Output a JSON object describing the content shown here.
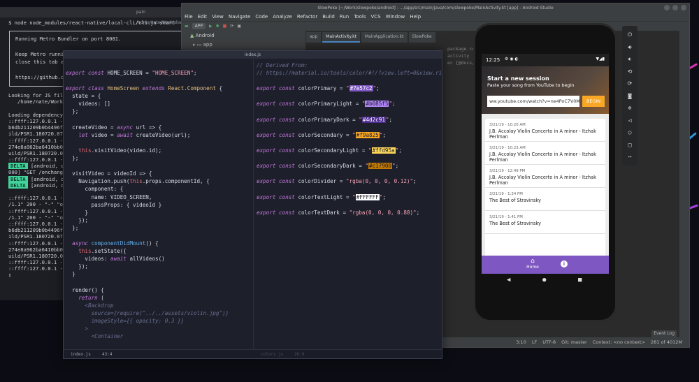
{
  "terminal": {
    "title": "pain /home/nate/Work/slow",
    "command": "$ node node_modules/react-native/local-cli/cli.js start",
    "box_lines": [
      "Running Metro Bundler on port 8081.",
      "",
      "Keep Metro runni",
      "close this tab a",
      "",
      "https://github.co"
    ],
    "log_lines": [
      "Looking for JS file",
      "   /home/nate/Work/",
      "",
      "Loading dependency",
      "::ffff:127.0.0.1 -",
      "b6db211209b0b4496fe",
      "ild/PSR1.180720.075",
      "::ffff:127.0.0.1 -",
      "274e8a962ba6410bb05",
      "uild/PSR1.180720.075",
      "::ffff:127.0.0.1 -"
    ],
    "delta_label": "DELTA",
    "delta_rows": [
      "[android, d",
      "000] \"GET /onchange",
      "[android, d",
      "[android, d"
    ],
    "log_lines_2": [
      "",
      "::ffff:127.0.0.1 -",
      "/1.1\" 200 - \"-\" \"ok",
      "::ffff:127.0.0.1 -",
      "/1.1\" 200 - \"-\" \"ok",
      "::ffff:127.0.0.1 -",
      "b6db211209b0b4496fe",
      "ild/PSR1.180720.075",
      "::ffff:127.0.0.1 -",
      "274e8a962ba6410bb05",
      "uild/PSR1.180720.075",
      "::ffff:127.0.0.1 -",
      "::ffff:127.0.0.1 -"
    ]
  },
  "studio": {
    "title": "SlowPoke [~/Work/slowpoke/android] - .../app/src/main/java/com/slowpoke/MainActivity.kt [app] - Android Studio",
    "menu": [
      "File",
      "Edit",
      "View",
      "Navigate",
      "Code",
      "Analyze",
      "Refactor",
      "Build",
      "Run",
      "Tools",
      "VCS",
      "Window",
      "Help"
    ],
    "toolbar_chips": [
      "APP",
      "Android"
    ],
    "project_item": "app",
    "tabs": [
      "app",
      "MainActivity.kt",
      "MainApplication.kt",
      "SlowPoke"
    ],
    "bg_code": [
      "package com.slowpoke",
      "",
      "",
      "activity",
      "",
      "",
      "",
      "",
      "",
      "ec {@docs/init"
    ],
    "status": [
      "3:10",
      "LF",
      "UTF-8",
      "Git: master",
      "Context: <no context>",
      "281 of 4012M"
    ],
    "event_log": "Event Log"
  },
  "editor": {
    "title": "index.js",
    "left_lines": [
      [
        [
          "kw",
          "export const "
        ],
        [
          "",
          "HOME_SCREEN = "
        ],
        [
          "str",
          "\"HOME_SCREEN\""
        ],
        [
          "",
          ";"
        ]
      ],
      [],
      [
        [
          "kw",
          "export class "
        ],
        [
          "cls",
          "HomeScreen "
        ],
        [
          "kw",
          "extends "
        ],
        [
          "cls",
          "React.Component "
        ],
        [
          "",
          "{"
        ]
      ],
      [
        [
          "",
          "  state = {"
        ]
      ],
      [
        [
          "",
          "    videos: []"
        ]
      ],
      [
        [
          "",
          "  };"
        ]
      ],
      [],
      [
        [
          "",
          "  createVideo = "
        ],
        [
          "kw",
          "async "
        ],
        [
          "",
          "url => {"
        ]
      ],
      [
        [
          "kw",
          "    let "
        ],
        [
          "",
          "video = "
        ],
        [
          "kw",
          "await "
        ],
        [
          "",
          "createVideo(url);"
        ]
      ],
      [],
      [
        [
          "th",
          "    this"
        ],
        [
          "",
          ".visitVideo(video.id);"
        ]
      ],
      [
        [
          "",
          "  };"
        ]
      ],
      [],
      [
        [
          "",
          "  visitVideo = videoId => {"
        ]
      ],
      [
        [
          "",
          "    Navigation.push("
        ],
        [
          "th",
          "this"
        ],
        [
          "",
          ".props.componentId, {"
        ]
      ],
      [
        [
          "",
          "      component: {"
        ]
      ],
      [
        [
          "",
          "        name: VIDEO_SCREEN,"
        ]
      ],
      [
        [
          "",
          "        passProps: { videoId }"
        ]
      ],
      [
        [
          "",
          "      }"
        ]
      ],
      [
        [
          "",
          "    });"
        ]
      ],
      [
        [
          "",
          "  };"
        ]
      ],
      [],
      [
        [
          "kw",
          "  async "
        ],
        [
          "fn",
          "componentDidMount"
        ],
        [
          "",
          "() {"
        ]
      ],
      [
        [
          "th",
          "    this"
        ],
        [
          "",
          ".setState({"
        ]
      ],
      [
        [
          "",
          "      videos: "
        ],
        [
          "kw",
          "await "
        ],
        [
          "",
          "allVideos()"
        ]
      ],
      [
        [
          "",
          "    });"
        ]
      ],
      [
        [
          "",
          "  }"
        ]
      ],
      [],
      [
        [
          "",
          "  render() {"
        ]
      ],
      [
        [
          "kw",
          "    return "
        ],
        [
          "",
          "("
        ]
      ],
      [
        [
          "cm",
          "      <Backdrop"
        ]
      ],
      [
        [
          "cm",
          "        source={require(\"../../assets/violin.jpg\")}"
        ]
      ],
      [
        [
          "cm",
          "        imageStyle={{ opacity: 0.3 }}"
        ]
      ],
      [
        [
          "cm",
          "      >"
        ]
      ],
      [
        [
          "cm",
          "        <Container"
        ]
      ]
    ],
    "right_comments": [
      "// Derived From:",
      "// https://material.io/tools/color/#!/?view.left=0&view.right=0&pr"
    ],
    "colors": [
      {
        "name": "colorPrimary",
        "value": "#7e57c2",
        "hex": "#7e57c2",
        "fg": "#ffffff"
      },
      {
        "name": "colorPrimaryLight",
        "value": "#b085f5",
        "hex": "#b085f5",
        "fg": "#1d1f2b"
      },
      {
        "name": "colorPrimaryDark",
        "value": "#4d2c91",
        "hex": "#4d2c91",
        "fg": "#ffffff"
      },
      {
        "name": "colorSecondary",
        "value": "#f9a825",
        "hex": "#f9a825",
        "fg": "#1d1f2b"
      },
      {
        "name": "colorSecondaryLight",
        "value": "#ffd95a",
        "hex": "#ffd95a",
        "fg": "#1d1f2b"
      },
      {
        "name": "colorSecondaryDark",
        "value": "#c17900",
        "hex": "#c17900",
        "fg": "#1d1f2b"
      },
      {
        "name": "colorDivider",
        "value": "rgba(0, 0, 0, 0.12)",
        "hex": "",
        "fg": ""
      },
      {
        "name": "colorTextLight",
        "value": "#FFFFFF",
        "hex": "#ffffff",
        "fg": "#1d1f2b"
      },
      {
        "name": "colorTextDark",
        "value": "rgba(0, 0, 0, 0.88)",
        "hex": "",
        "fg": ""
      }
    ],
    "status_left": "index.js",
    "status_pos": "43:4",
    "status_right_file": "colors.js",
    "status_right_pos": "26:0"
  },
  "phone": {
    "time": "12:25",
    "header_title": "Start a new session",
    "header_subtitle": "Paste your song from YouTube to begin",
    "url_value": "ww.youtube.com/watch?v=ne4PoC7V0Mk",
    "begin_label": "BEGIN",
    "sessions": [
      {
        "time": "3/21/19 - 10:20 AM",
        "title": "J.B. Accolay Violin Concerto in A minor - Itzhak Perlman"
      },
      {
        "time": "3/21/19 - 10:23 AM",
        "title": "J.B. Accolay Violin Concerto in A minor - Itzhak Perlman"
      },
      {
        "time": "3/21/19 - 12:49 PM",
        "title": "J.B. Accolay Violin Concerto in A minor - Itzhak Perlman"
      },
      {
        "time": "3/21/19 - 1:34 PM",
        "title": "The Best of Stravinsky"
      },
      {
        "time": "3/21/19 - 1:41 PM",
        "title": "The Best of Stravinsky"
      }
    ],
    "nav_home": "Home",
    "accent": "#7e57c2",
    "begin_color": "#f9a825"
  }
}
